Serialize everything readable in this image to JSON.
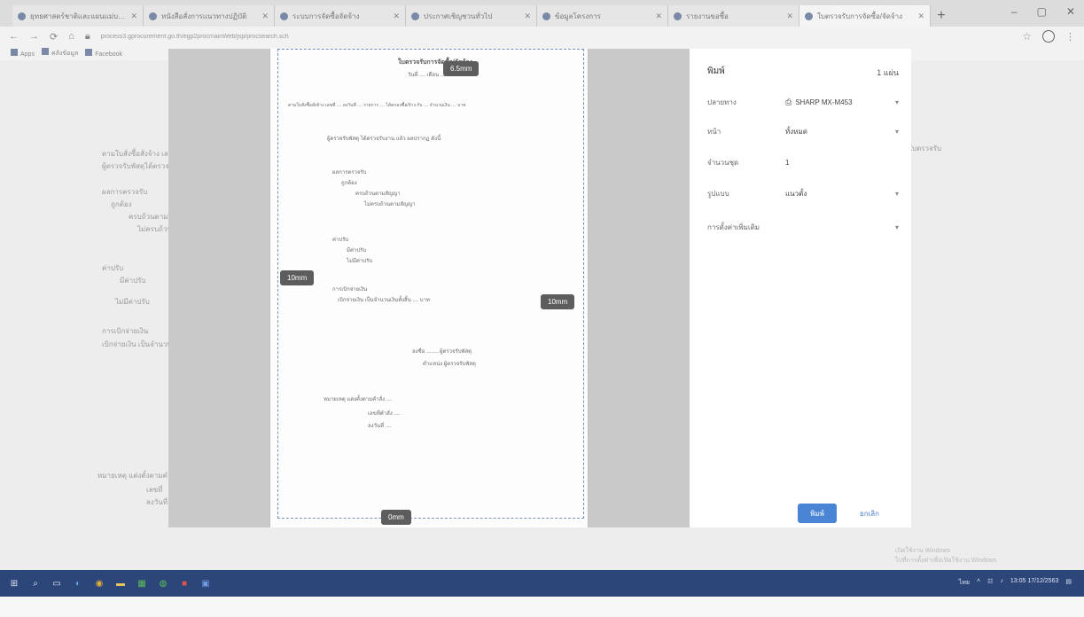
{
  "browser": {
    "tabs": [
      {
        "label": "ยุทธศาสตร์ชาติและแผนแม่บทภายใต้ยุทธศาสตร์ชาติ",
        "active": false
      },
      {
        "label": "หนังสือสั่งการแนวทางปฏิบัติ",
        "active": false
      },
      {
        "label": "ระบบการจัดซื้อจัดจ้าง",
        "active": false
      },
      {
        "label": "ประกาศเชิญชวนทั่วไป",
        "active": false
      },
      {
        "label": "ข้อมูลโครงการ",
        "active": false
      },
      {
        "label": "รายงานขอซื้อ",
        "active": false
      },
      {
        "label": "ใบตรวจรับการจัดซื้อ/จัดจ้าง",
        "active": true
      }
    ],
    "new_tab": "+",
    "window_controls": [
      "–",
      "▢",
      "✕"
    ],
    "url": "process3.gprocurement.go.th/egp2procmainWeb/jsp/procsearch.sch",
    "bookmarks": [
      "Apps",
      "คลังข้อมูล",
      "Facebook"
    ]
  },
  "background_page": {
    "lines": [
      "ตามใบสั่งซื้อสั่งจ้าง เลขที่",
      "ผู้ตรวจรับพัสดุได้ตรวจรับ",
      "ผลการตรวจรับ",
      "ถูกต้อง",
      "ครบถ้วนตามสัญญา",
      "ไม่ครบถ้วนตามสัญญา",
      "ค่าปรับ",
      "มีค่าปรับ",
      "ไม่มีค่าปรับ",
      "การเบิกจ่ายเงิน",
      "เบิกจ่ายเงิน เป็นจำนวนเงินทั้งสิ้น",
      "ใบตรวจรับ",
      "หมายเหตุ แต่งตั้งตามคำสั่ง",
      "เลขที่",
      "ลงวันที่"
    ]
  },
  "preview": {
    "margins": {
      "top": "6.5mm",
      "left": "10mm",
      "right": "10mm",
      "bottom": "0mm"
    },
    "doc_lines": [
      "ใบตรวจรับการจัดซื้อ/จัดจ้าง",
      "วันที่ .... เดือน .... พ.ศ. ....",
      "ตามใบสั่งซื้อสั่งจ้าง เลขที่ .... ลงวันที่ .... รายการ .... ได้ตกลงซื้อ/จ้าง กับ .... จำนวนเงิน .... บาท",
      "ผู้ตรวจรับพัสดุ ได้ตรวจรับงาน แล้ว ผลปรากฏ ดังนี้",
      "ผลการตรวจรับ",
      "ถูกต้อง",
      "ครบถ้วนตามสัญญา",
      "ไม่ครบถ้วนตามสัญญา",
      "ค่าปรับ",
      "มีค่าปรับ",
      "ไม่มีค่าปรับ",
      "การเบิกจ่ายเงิน",
      "เบิกจ่ายเงิน เป็นจำนวนเงินทั้งสิ้น .... บาท",
      "ลงชื่อ ........ ผู้ตรวจรับพัสดุ",
      "ตำแหน่ง ผู้ตรวจรับพัสดุ",
      "หมายเหตุ แต่งตั้งตามคำสั่ง ....",
      "เลขที่คำสั่ง ....",
      "ลงวันที่ ...."
    ]
  },
  "print_settings": {
    "title": "พิมพ์",
    "page_count": "1 แผ่น",
    "rows": [
      {
        "label": "ปลายทาง",
        "value": "SHARP MX-M453",
        "icon": "printer-icon"
      },
      {
        "label": "หน้า",
        "value": "ทั้งหมด"
      },
      {
        "label": "จำนวนชุด",
        "value": "1"
      },
      {
        "label": "รูปแบบ",
        "value": "แนวตั้ง"
      },
      {
        "label": "การตั้งค่าเพิ่มเติม",
        "value": ""
      }
    ],
    "print_button": "พิมพ์",
    "cancel_button": "ยกเลิก"
  },
  "watermark": {
    "line1": "เปิดใช้งาน Windows",
    "line2": "ไปที่การตั้งค่าเพื่อเปิดใช้งาน Windows"
  },
  "taskbar": {
    "clock_time": "13:05",
    "clock_date": "17/12/2563",
    "language": "ไทย"
  }
}
